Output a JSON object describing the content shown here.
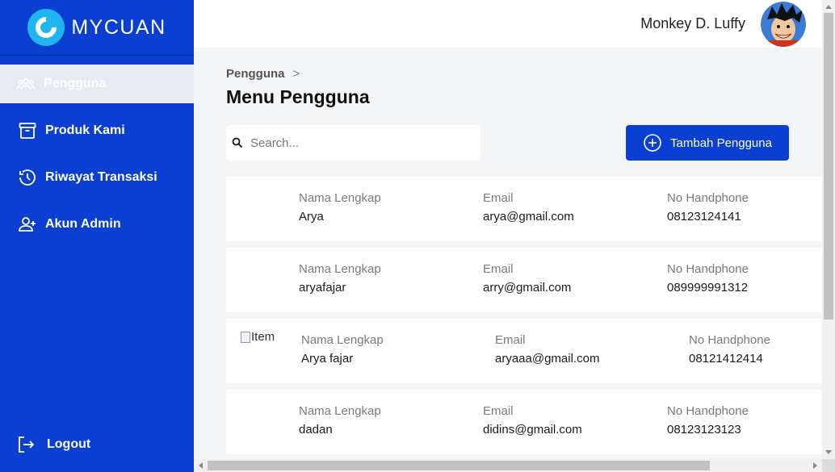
{
  "brand": {
    "name": "MYCUAN"
  },
  "sidebar": {
    "items": [
      {
        "label": "Pengguna",
        "icon": "users-icon",
        "active": true
      },
      {
        "label": "Produk Kami",
        "icon": "archive-box-icon",
        "active": false
      },
      {
        "label": "Riwayat Transaksi",
        "icon": "history-icon",
        "active": false
      },
      {
        "label": "Akun Admin",
        "icon": "user-plus-icon",
        "active": false
      }
    ],
    "logout_label": "Logout"
  },
  "header": {
    "user_name": "Monkey D. Luffy"
  },
  "main": {
    "breadcrumb": {
      "current": "Pengguna",
      "separator": ">"
    },
    "title": "Menu Pengguna",
    "search": {
      "placeholder": "Search...",
      "value": ""
    },
    "add_button_label": "Tambah Pengguna",
    "columns": {
      "name": "Nama Lengkap",
      "email": "Email",
      "phone": "No Handphone"
    },
    "broken_image_alt": "Item",
    "users": [
      {
        "name": "Arya",
        "email": "arya@gmail.com",
        "phone": "08123124141"
      },
      {
        "name": "aryafajar",
        "email": "arry@gmail.com",
        "phone": "089999991312"
      },
      {
        "name": "Arya fajar",
        "email": "aryaaa@gmail.com",
        "phone": "08121412414"
      },
      {
        "name": "dadan",
        "email": "didins@gmail.com",
        "phone": "08123123123"
      }
    ]
  },
  "colors": {
    "primary": "#0a3fd1",
    "brand_logo": "#1fb6f0",
    "background": "#f3f4f6"
  }
}
